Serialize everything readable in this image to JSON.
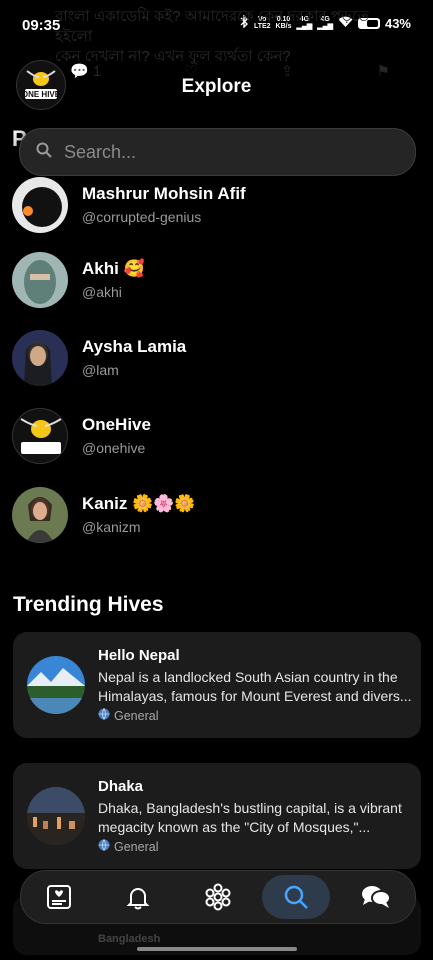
{
  "status": {
    "time": "09:35",
    "net1": "Vo\nLTE2",
    "speed": "0.10\nKB/s",
    "g1": "4G",
    "g2": "4G",
    "battery": "43%"
  },
  "background": {
    "post_text": "বাংলা একাডেমি কই? আমাদেরকে কেন দরকার পড়তে হইলো\nকেন দেখলা না? এখন ফুল ব্যর্থতা কেন?",
    "reply_count": "1"
  },
  "header": {
    "title": "Explore",
    "logo_text": "ONE HIVE",
    "obscured_letter": "P"
  },
  "search": {
    "placeholder": "Search..."
  },
  "users": [
    {
      "name": "Mashrur Mohsin Afif",
      "handle": "@corrupted-genius",
      "emoji": ""
    },
    {
      "name": "Akhi",
      "handle": "@akhi",
      "emoji": "🥰"
    },
    {
      "name": "Aysha Lamia",
      "handle": "@lam",
      "emoji": ""
    },
    {
      "name": "OneHive",
      "handle": "@onehive",
      "emoji": ""
    },
    {
      "name": "Kaniz",
      "handle": "@kanizm",
      "emoji": "🌼🌸🌼"
    }
  ],
  "trending": {
    "title": "Trending Hives",
    "hives": [
      {
        "name": "Hello Nepal",
        "desc": "Nepal is a landlocked South Asian country in the Himalayas, famous for Mount Everest and divers...",
        "category": "General"
      },
      {
        "name": "Dhaka",
        "desc": "Dhaka, Bangladesh's bustling capital, is a vibrant megacity known as the \"City of Mosques,\"...",
        "category": "General"
      }
    ],
    "peek_label": "Bangladesh"
  },
  "colors": {
    "background": "#000000",
    "card": "#1c1c1c",
    "active_nav": "#2e3b4a",
    "accent": "#4aa3ff",
    "logo_yellow": "#f5c518"
  },
  "nav": {
    "items": [
      "feed-icon",
      "bell-icon",
      "hive-icon",
      "search-icon",
      "chat-icon"
    ],
    "active": "search-icon"
  }
}
